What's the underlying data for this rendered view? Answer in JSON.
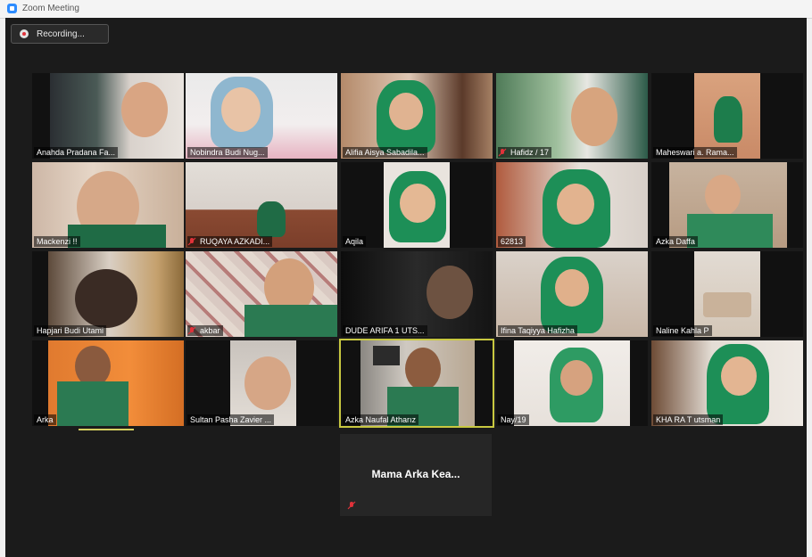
{
  "window": {
    "title": "Zoom Meeting"
  },
  "recording": {
    "label": "Recording..."
  },
  "colors": {
    "background": "#1b1b1b",
    "active_speaker": "#c8c840",
    "muted": "#e0323a"
  },
  "participants": [
    {
      "name": "Anahda Pradana Fa..."
    },
    {
      "name": "Nobindra Budi Nug..."
    },
    {
      "name": "Alifia Aisya Sabadila..."
    },
    {
      "name": "Hafidz / 17"
    },
    {
      "name": "Maheswari a. Rama..."
    },
    {
      "name": "Mackenzi !!"
    },
    {
      "name": "RUQAYA AZKADI..."
    },
    {
      "name": "Aqila"
    },
    {
      "name": "62813"
    },
    {
      "name": "Azka Daffa"
    },
    {
      "name": "Hapjari Budi Utami"
    },
    {
      "name": "akbar"
    },
    {
      "name": "DUDE ARIFA 1 UTS..."
    },
    {
      "name": "Ifina Taqiyya Hafizha"
    },
    {
      "name": "Naline Kahla P"
    },
    {
      "name": "Arka"
    },
    {
      "name": "Sultan Pasha Zavier ..."
    },
    {
      "name": "Azka Naufal Atharız"
    },
    {
      "name": "Nay/19"
    },
    {
      "name": "KHA RA T utsman"
    }
  ],
  "avatar_participant": {
    "name": "Mama Arka Kea..."
  }
}
